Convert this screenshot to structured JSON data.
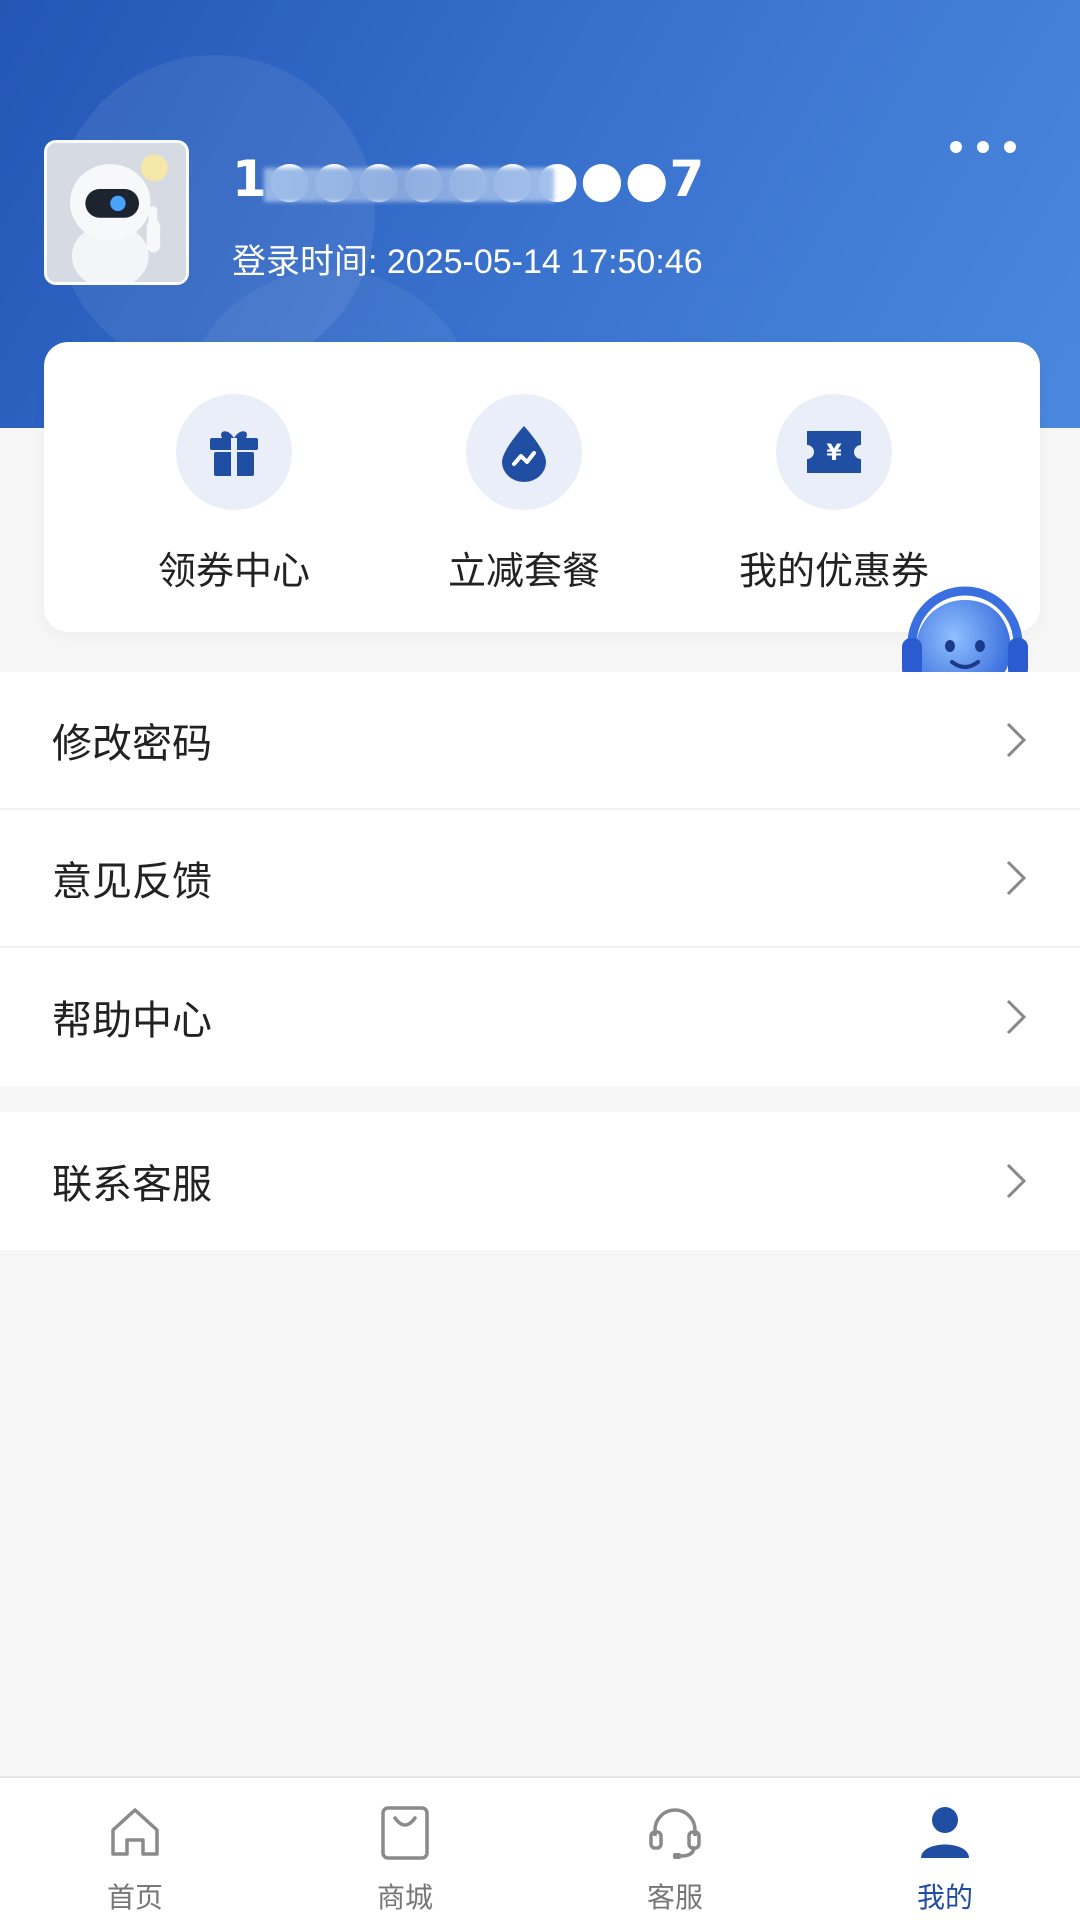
{
  "profile": {
    "username": "1●●●●●●●●●7",
    "login_time": "登录时间: 2025-05-14 17:50:46"
  },
  "quick_actions": [
    {
      "label": "领券中心",
      "icon": "gift-icon"
    },
    {
      "label": "立减套餐",
      "icon": "drop-icon"
    },
    {
      "label": "我的优惠券",
      "icon": "coupon-icon"
    }
  ],
  "menu": {
    "group1": [
      {
        "label": "修改密码"
      },
      {
        "label": "意见反馈"
      },
      {
        "label": "帮助中心"
      }
    ],
    "group2": [
      {
        "label": "联系客服"
      }
    ]
  },
  "tabbar": [
    {
      "label": "首页",
      "icon": "home-icon",
      "active": false
    },
    {
      "label": "商城",
      "icon": "shopping-bag-icon",
      "active": false
    },
    {
      "label": "客服",
      "icon": "headset-icon",
      "active": false
    },
    {
      "label": "我的",
      "icon": "user-icon",
      "active": true
    }
  ],
  "colors": {
    "brand_blue": "#2356b6",
    "icon_blue": "#1f4ea3",
    "icon_circle_bg": "#e9eef8",
    "page_bg": "#f6f6f7"
  }
}
